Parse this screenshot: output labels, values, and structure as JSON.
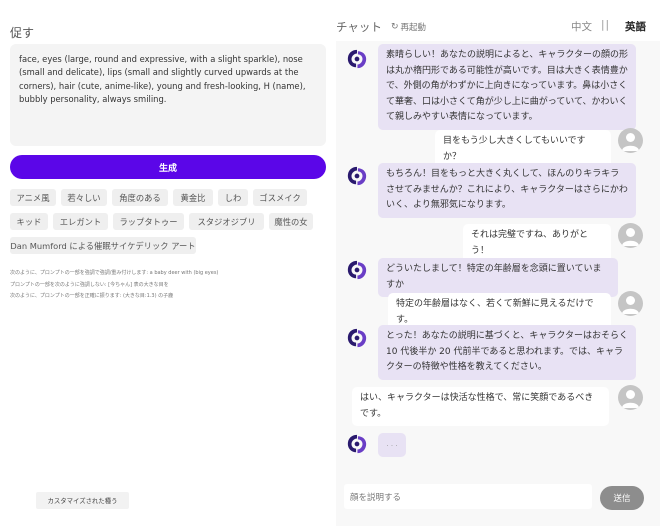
{
  "prompt": {
    "title": "促す",
    "text": "face, eyes (large, round and expressive, with a slight sparkle), nose (small and delicate), lips (small and slightly curved upwards at the corners), hair (cute, anime-like), young and fresh-looking, H (name), bubbly personality, always smiling.",
    "generate_label": "生成",
    "tags": [
      "アニメ風",
      "若々しい",
      "角度のある",
      "黄金比",
      "しわ",
      "ゴスメイク",
      "キッド",
      "エレガント",
      "ラップタトゥー",
      "スタジオジブリ",
      "魔性の女",
      "Dan Mumford による催眠サイケデリック アート"
    ],
    "help_lines": [
      "次のように、プロンプトの一部を強調で強調/重み付けします: a baby deer with (big eyes)",
      "プロンプトの一部を次のように強調しない: [今ちゃん] 表の大きな目を",
      "次のように、プロンプトの一部を正確に振ります: (大きな目:1.3) の子鹿"
    ],
    "custom_label": "カスタマイズされた種う"
  },
  "chat": {
    "title": "チャット",
    "restart_label": "再起動",
    "lang_zh": "中文",
    "lang_sep": "||",
    "lang_ja": "英語",
    "messages": [
      {
        "role": "bot",
        "text": "素晴らしい！あなたの説明によると、キャラクターの顔の形は丸か楕円形である可能性が高いです。目は大きく表情豊かで、外側の角がわずかに上向きになっています。鼻は小さくて華奢、口は小さくて角が少し上に曲がっていて、かわいくて親しみやすい表情になっています。"
      },
      {
        "role": "user",
        "text": "目をもう少し大きくしてもいいですか？"
      },
      {
        "role": "bot",
        "text": "もちろん！目をもっと大きく丸くして、ほんのりキラキラさせてみませんか？これにより、キャラクターはさらにかわいく、より無邪気になります。"
      },
      {
        "role": "user",
        "text": "それは完璧ですね、ありがとう！"
      },
      {
        "role": "bot",
        "text": "どういたしまして！特定の年齢層を念頭に置いていますか"
      },
      {
        "role": "user",
        "text": "特定の年齢層はなく、若くて新鮮に見えるだけです。"
      },
      {
        "role": "bot",
        "text": "とった！あなたの説明に基づくと、キャラクターはおそらく10 代後半か 20 代前半であると思われます。では、キャラクターの特徴や性格を教えてください。"
      },
      {
        "role": "user",
        "text": "はい、キャラクターは快活な性格で、常に笑顔であるべきです。"
      },
      {
        "role": "bot",
        "text": ". . ."
      }
    ],
    "input_placeholder": "顔を説明する",
    "send_label": "送信"
  },
  "colors": {
    "accent": "#5b06e8",
    "bot_bubble": "#e8e2f4",
    "bot_logo": "#2a1a6e"
  }
}
